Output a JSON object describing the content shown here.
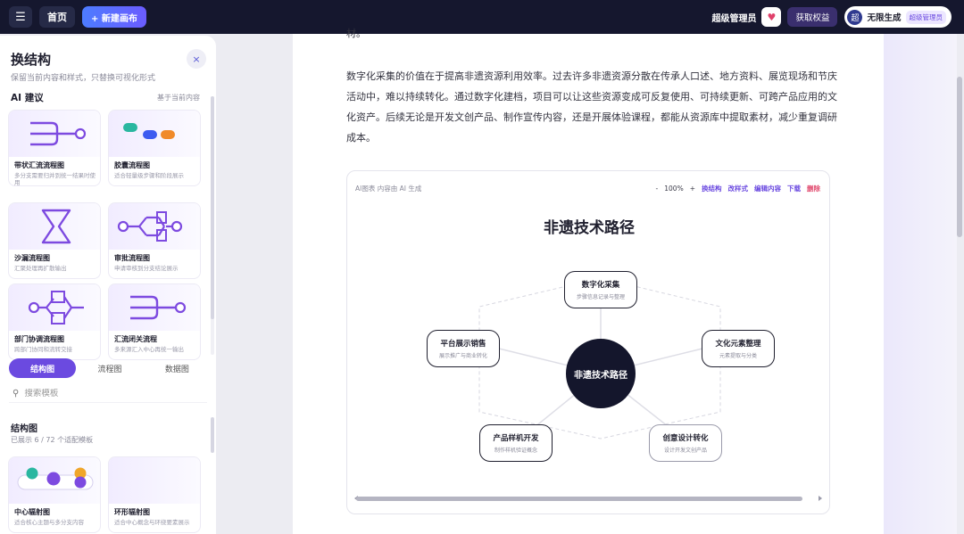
{
  "topbar": {
    "menu_icon": "menu-icon",
    "home_label": "首页",
    "new_canvas_label": "+ 新建画布",
    "user_name": "超级管理员",
    "heart_icon": "heart-icon",
    "rights_label": "获取权益",
    "avatar_text": "超",
    "plan_name": "无限生成",
    "plan_tag": "超级管理员"
  },
  "panel": {
    "title": "换结构",
    "subtitle": "保留当前内容和样式，只替换可视化形式",
    "close_icon": "×",
    "ai_label": "AI 建议",
    "ai_hint": "基于当前内容",
    "suggestions": [
      {
        "name": "带状汇流流程图",
        "desc": "多分支需要归并到统一结果时使用"
      },
      {
        "name": "胶囊流程图",
        "desc": "适合轻量级步骤和阶段展示"
      },
      {
        "name": "沙漏流程图",
        "desc": "汇聚处理再扩散输出"
      },
      {
        "name": "审批流程图",
        "desc": "申请审核到分支结论展示"
      },
      {
        "name": "部门协调流程图",
        "desc": "跨部门协同和流转交接"
      },
      {
        "name": "汇流闭关流程",
        "desc": "多来源汇入中心再统一输出"
      }
    ],
    "tabs": [
      "结构图",
      "流程图",
      "数据图"
    ],
    "active_tab": 0,
    "search_placeholder": "搜索模板",
    "section_title": "结构图",
    "section_sub": "已展示 6 / 72 个适配模板",
    "templates": [
      {
        "name": "中心辐射图",
        "desc": "适合核心主题与多分支内容"
      },
      {
        "name": "环形辐射图",
        "desc": "适合中心概念与环绕要素展示"
      }
    ]
  },
  "doc": {
    "para1": "材。",
    "para2": "数字化采集的价值在于提高非遗资源利用效率。过去许多非遗资源分散在传承人口述、地方资料、展览现场和节庆活动中，难以持续转化。通过数字化建档，项目可以让这些资源变成可反复使用、可持续更新、可跨产品应用的文化资产。后续无论是开发文创产品、制作宣传内容，还是开展体验课程，都能从资源库中提取素材，减少重复调研成本。"
  },
  "embed": {
    "tag": "AI图表 内容由 AI 生成",
    "tools": {
      "minus": "-",
      "zoom": "100%",
      "plus": "+",
      "switch": "换结构",
      "style": "改样式",
      "edit": "编辑内容",
      "download": "下载",
      "delete": "删除"
    },
    "title": "非遗技术路径",
    "center": "非遗技术路径",
    "nodes": [
      {
        "title": "数字化采集",
        "desc": "步骤信息记录与整理"
      },
      {
        "title": "文化元素整理",
        "desc": "元素提取与分类"
      },
      {
        "title": "创意设计转化",
        "desc": "设计开发文创产品"
      },
      {
        "title": "产品样机开发",
        "desc": "制作样机验证概念"
      },
      {
        "title": "平台展示销售",
        "desc": "展示推广与商业转化"
      }
    ]
  },
  "colors": {
    "accent": "#6b4ae0",
    "topbar": "#15172e",
    "danger": "#e0466b"
  }
}
